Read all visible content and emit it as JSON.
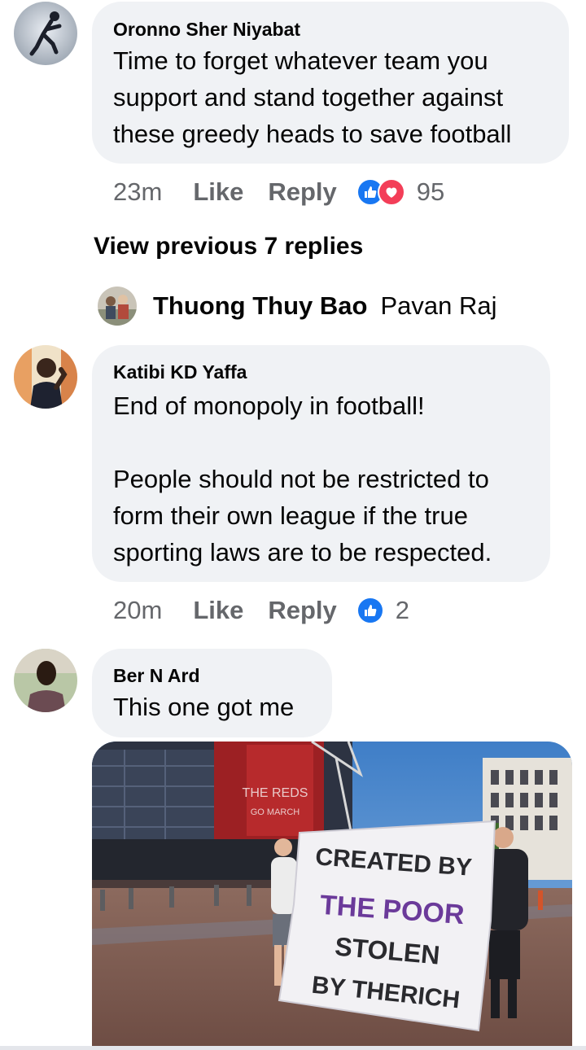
{
  "comments": [
    {
      "author": "Oronno Sher Niyabat",
      "text": "Time to forget whatever team you\nsupport and stand together against\nthese greedy heads to save football",
      "time": "23m",
      "like_label": "Like",
      "reply_label": "Reply",
      "reaction_count": "95",
      "reactions": [
        "like-icon",
        "love-icon"
      ]
    },
    {
      "author": "Katibi KD Yaffa",
      "text": "End of monopoly in football!\n\nPeople should not be restricted to\nform their own league if the true\nsporting laws are to be respected.",
      "time": "20m",
      "like_label": "Like",
      "reply_label": "Reply",
      "reaction_count": "2",
      "reactions": [
        "like-icon"
      ]
    },
    {
      "author": "Ber N Ard",
      "text": "This one got me"
    }
  ],
  "view_previous_label": "View previous 7 replies",
  "reply_preview": {
    "author": "Thuong Thuy Bao",
    "mention": "Pavan Raj"
  },
  "photo": {
    "sign_sub": "THE REDS\nGO MARCH",
    "banner_lines": [
      "CREATED BY",
      "THE POOR",
      "STOLEN",
      "BY THERICH"
    ]
  },
  "colors": {
    "like_blue": "#1877f2",
    "love_red": "#f33e58",
    "bubble_bg": "#f0f2f5",
    "meta_gray": "#65676b"
  }
}
